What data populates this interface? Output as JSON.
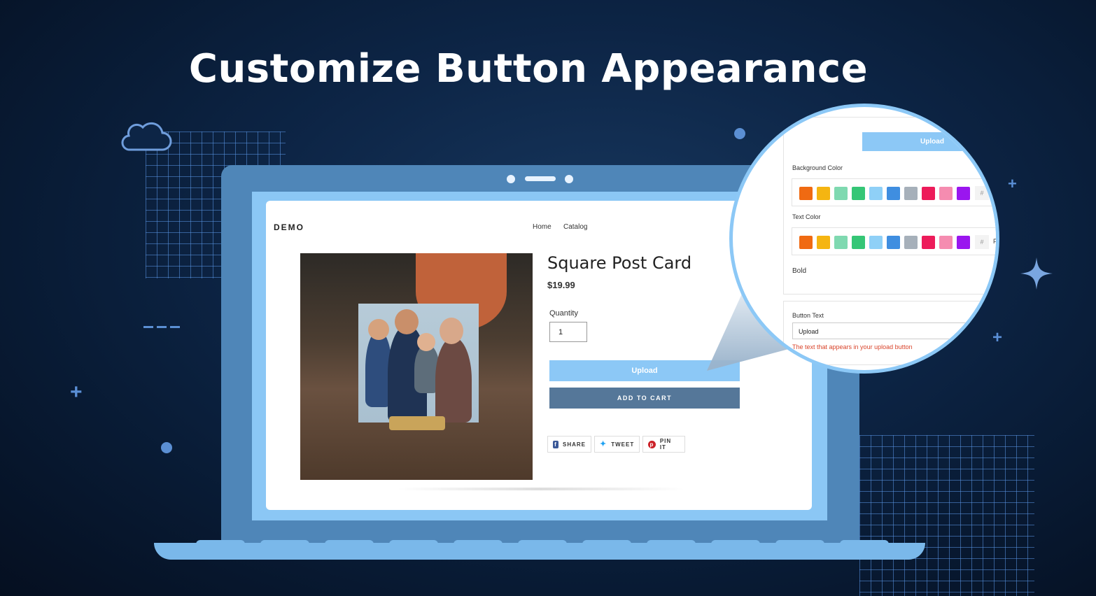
{
  "headline": "Customize Button Appearance",
  "store": {
    "logo": "DEMO",
    "nav": [
      "Home",
      "Catalog"
    ]
  },
  "product": {
    "title": "Square Post Card",
    "price": "$19.99",
    "quantity_label": "Quantity",
    "quantity_value": "1",
    "upload_button": "Upload",
    "cart_button": "ADD TO CART",
    "share_buttons": [
      {
        "label": "SHARE",
        "icon": "facebook-icon",
        "color": "#3b5998"
      },
      {
        "label": "TWEET",
        "icon": "twitter-icon",
        "color": "#1da1f2"
      },
      {
        "label": "PIN IT",
        "icon": "pinterest-icon",
        "color": "#cb2027"
      }
    ]
  },
  "settings": {
    "preview_button": "Upload",
    "background_color_label": "Background Color",
    "text_color_label": "Text Color",
    "bold_label": "Bold",
    "button_text_label": "Button Text",
    "button_text_value": "Upload",
    "button_text_help": "The text that appears in your upload button",
    "hash_symbol": "#",
    "text_color_hex_partial": "FF",
    "swatches": [
      "#f06a12",
      "#f5b511",
      "#7fd9b0",
      "#35c676",
      "#8fd0f7",
      "#3f8ee0",
      "#a6b0ba",
      "#ed1b5a",
      "#f58cb0",
      "#9a16ef"
    ]
  },
  "colors": {
    "accent_upload": "#8cc8f6",
    "cart_button": "#557799",
    "help_text": "#d9442b"
  }
}
